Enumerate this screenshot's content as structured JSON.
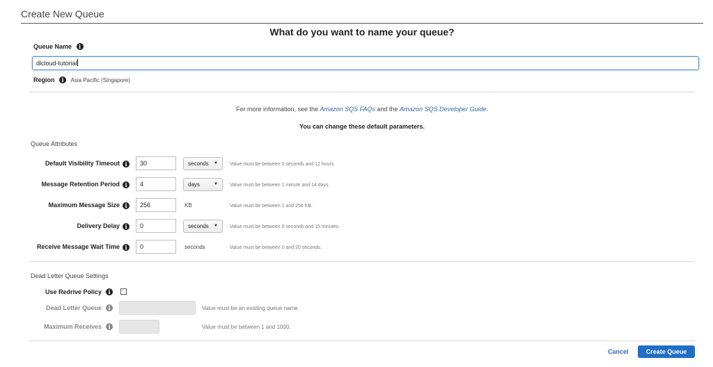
{
  "dialog": {
    "title": "Create New Queue",
    "heading": "What do you want to name your queue?"
  },
  "queue_name": {
    "label": "Queue Name",
    "value": "dlcloud-tutorial"
  },
  "region": {
    "label": "Region",
    "value": "Asia Pacific (Singapore)"
  },
  "info_line": {
    "prefix": "For more information, see the",
    "link1": "Amazon SQS FAQs",
    "middle": "and the",
    "link2": "Amazon SQS Developer Guide",
    "suffix": "."
  },
  "defaults_note": "You can change these default parameters.",
  "queue_attributes": {
    "section_label": "Queue Attributes",
    "rows": [
      {
        "label": "Default Visibility Timeout",
        "value": "30",
        "unit": "seconds",
        "unit_type": "select",
        "hint": "Value must be between 0 seconds and 12 hours."
      },
      {
        "label": "Message Retention Period",
        "value": "4",
        "unit": "days",
        "unit_type": "select",
        "hint": "Value must be between 1 minute and 14 days."
      },
      {
        "label": "Maximum Message Size",
        "value": "256",
        "unit": "KB",
        "unit_type": "text",
        "hint": "Value must be between 1 and 256 KB."
      },
      {
        "label": "Delivery Delay",
        "value": "0",
        "unit": "seconds",
        "unit_type": "select",
        "hint": "Value must be between 0 seconds and 15 minutes."
      },
      {
        "label": "Receive Message Wait Time",
        "value": "0",
        "unit": "seconds",
        "unit_type": "text",
        "hint": "Value must be between 0 and 20 seconds."
      }
    ]
  },
  "dead_letter": {
    "section_label": "Dead Letter Queue Settings",
    "redrive_label": "Use Redrive Policy",
    "redrive_checked": false,
    "dlq_label": "Dead Letter Queue",
    "dlq_hint": "Value must be an existing queue name.",
    "max_receives_label": "Maximum Receives",
    "max_receives_hint": "Value must be between 1 and 1000."
  },
  "footer": {
    "cancel_label": "Cancel",
    "create_label": "Create Queue"
  },
  "colors": {
    "primary_button": "#1f6fc5",
    "link": "#3366aa",
    "focus_border": "#4a90d9"
  },
  "icons": {
    "info": "info-circle-icon",
    "dropdown": "chevron-down-icon"
  }
}
